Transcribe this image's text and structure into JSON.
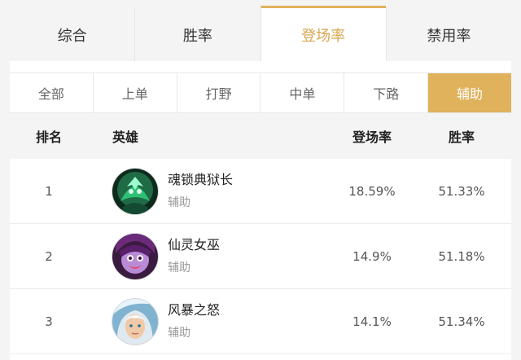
{
  "top_tabs": [
    {
      "label": "综合"
    },
    {
      "label": "胜率"
    },
    {
      "label": "登场率"
    },
    {
      "label": "禁用率"
    }
  ],
  "active_top_tab": "登场率",
  "lane_tabs": [
    {
      "label": "全部"
    },
    {
      "label": "上单"
    },
    {
      "label": "打野"
    },
    {
      "label": "中单"
    },
    {
      "label": "下路"
    },
    {
      "label": "辅助"
    }
  ],
  "active_lane_tab": "辅助",
  "columns": {
    "rank": "排名",
    "hero": "英雄",
    "pick_rate": "登场率",
    "win_rate": "胜率"
  },
  "rows": [
    {
      "rank": "1",
      "name": "魂锁典狱长",
      "role": "辅助",
      "pick_rate": "18.59%",
      "win_rate": "51.33%",
      "avatar_icon": "thresh-portrait"
    },
    {
      "rank": "2",
      "name": "仙灵女巫",
      "role": "辅助",
      "pick_rate": "14.9%",
      "win_rate": "51.18%",
      "avatar_icon": "lulu-portrait"
    },
    {
      "rank": "3",
      "name": "风暴之怒",
      "role": "辅助",
      "pick_rate": "14.1%",
      "win_rate": "51.34%",
      "avatar_icon": "janna-portrait"
    }
  ],
  "colors": {
    "accent": "#e0b25c",
    "active_top_text": "#d9a54d"
  }
}
